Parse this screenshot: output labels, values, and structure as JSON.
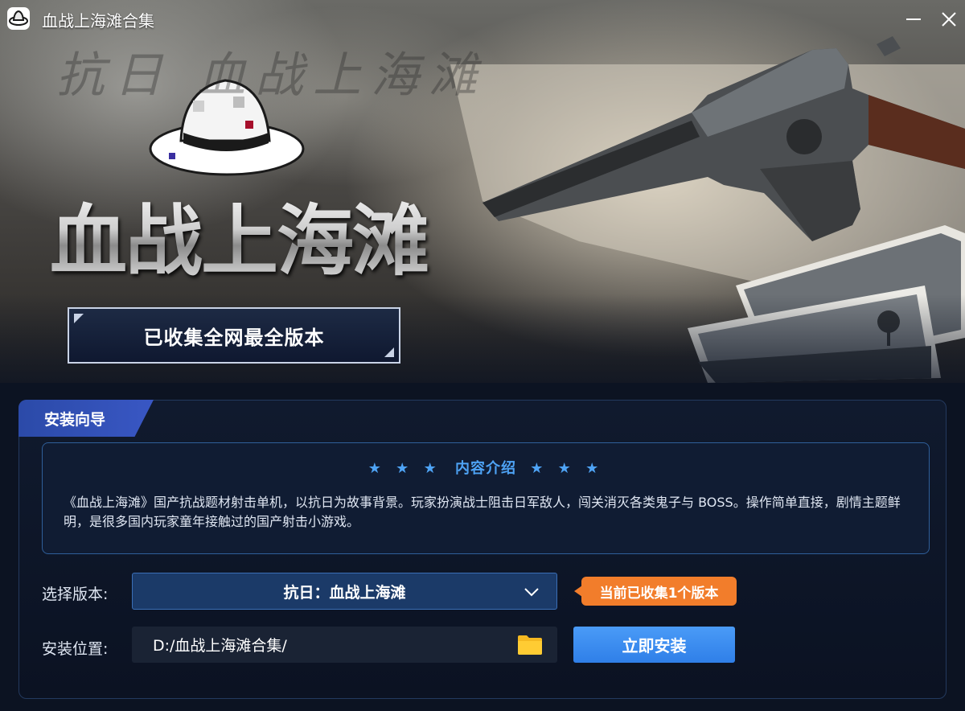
{
  "window": {
    "title": "血战上海滩合集",
    "minimize_icon": "minimize-icon",
    "close_icon": "close-icon"
  },
  "banner": {
    "game_logo": "血战上海滩",
    "background_calligraphy": "抗日 血战上海滩",
    "badge": "已收集全网最全版本"
  },
  "installer": {
    "tab_label": "安装向导",
    "intro": {
      "heading": "内容介绍",
      "stars": "★ ★ ★",
      "text": "《血战上海滩》国产抗战题材射击单机，以抗日为故事背景。玩家扮演战士阻击日军敌人，闯关消灭各类鬼子与 BOSS。操作简单直接，剧情主题鲜明，是很多国内玩家童年接触过的国产射击小游戏。"
    },
    "version": {
      "label": "选择版本:",
      "selected": "抗日：血战上海滩",
      "collected_tag": "当前已收集1个版本"
    },
    "location": {
      "label": "安装位置:",
      "path": "D:/血战上海滩合集/",
      "folder_icon": "folder-icon"
    },
    "install_button": "立即安装"
  },
  "colors": {
    "accent_blue": "#4ea3f5",
    "tag_orange": "#f27d2b",
    "button_blue": "#2f7fe8",
    "select_bg": "#1b3a68"
  }
}
